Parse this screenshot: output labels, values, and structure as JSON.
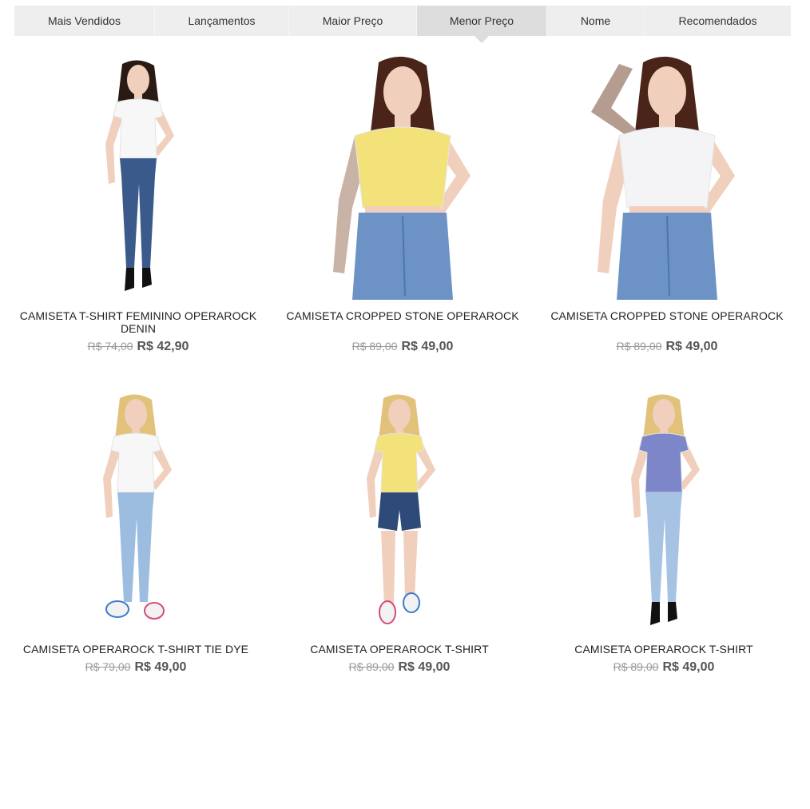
{
  "sort_tabs": [
    {
      "label": "Mais Vendidos",
      "active": false
    },
    {
      "label": "Lançamentos",
      "active": false
    },
    {
      "label": "Maior Preço",
      "active": false
    },
    {
      "label": "Menor Preço",
      "active": true
    },
    {
      "label": "Nome",
      "active": false
    },
    {
      "label": "Recomendados",
      "active": false
    }
  ],
  "products": [
    {
      "name": "CAMISETA T-SHIRT FEMININO OPERAROCK DENIN",
      "old_price": "R$ 74,00",
      "price": "R$ 42,90",
      "shirt_color": "#f7f7f7",
      "bottom_color": "#3a5a8c",
      "hair_color": "#2a1a14"
    },
    {
      "name": "CAMISETA CROPPED STONE OPERAROCK",
      "old_price": "R$ 89,00",
      "price": "R$ 49,00",
      "shirt_color": "#f3e27a",
      "bottom_color": "#6d93c6",
      "hair_color": "#4a2418"
    },
    {
      "name": "CAMISETA CROPPED STONE OPERAROCK",
      "old_price": "R$ 89,00",
      "price": "R$ 49,00",
      "shirt_color": "#f4f4f6",
      "bottom_color": "#6d93c6",
      "hair_color": "#4a2418"
    },
    {
      "name": "CAMISETA OPERAROCK T-SHIRT TIE DYE",
      "old_price": "R$ 79,00",
      "price": "R$ 49,00",
      "shirt_color": "#f7f7f7",
      "bottom_color": "#9cbde0",
      "hair_color": "#e2c27a"
    },
    {
      "name": "CAMISETA OPERAROCK T-SHIRT",
      "old_price": "R$ 89,00",
      "price": "R$ 49,00",
      "shirt_color": "#f3e27a",
      "bottom_color": "#2d4a78",
      "hair_color": "#e2c27a"
    },
    {
      "name": "CAMISETA OPERAROCK T-SHIRT",
      "old_price": "R$ 89,00",
      "price": "R$ 49,00",
      "shirt_color": "#7d86c8",
      "bottom_color": "#a6c3e4",
      "hair_color": "#e2c27a"
    }
  ]
}
